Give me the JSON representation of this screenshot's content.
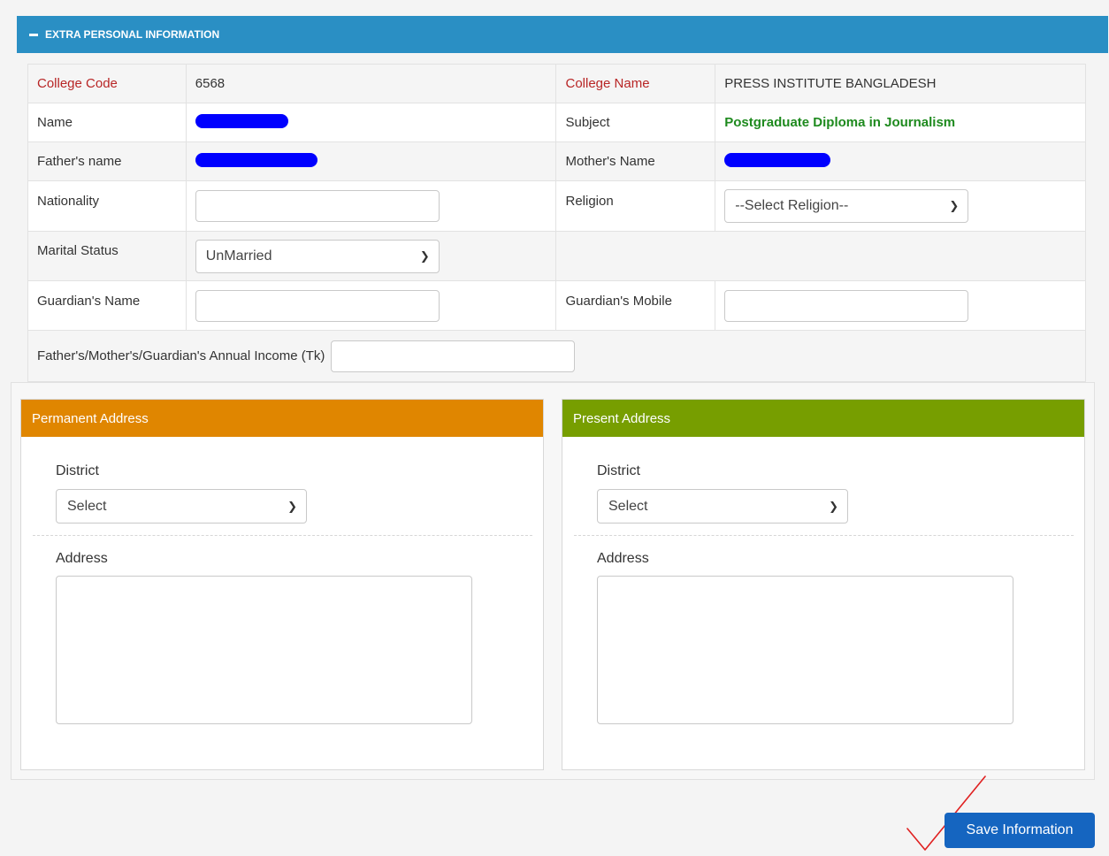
{
  "panel": {
    "title": "EXTRA PERSONAL INFORMATION"
  },
  "rows": {
    "college_code_label": "College Code",
    "college_code_value": "6568",
    "college_name_label": "College Name",
    "college_name_value": "PRESS INSTITUTE BANGLADESH",
    "name_label": "Name",
    "subject_label": "Subject",
    "subject_value": "Postgraduate Diploma in Journalism",
    "father_label": "Father's name",
    "mother_label": "Mother's Name",
    "nationality_label": "Nationality",
    "nationality_value": "",
    "religion_label": "Religion",
    "religion_selected": "--Select Religion--",
    "marital_label": "Marital Status",
    "marital_selected": "UnMarried",
    "guardian_name_label": "Guardian's Name",
    "guardian_name_value": "",
    "guardian_mobile_label": "Guardian's Mobile",
    "guardian_mobile_value": "",
    "income_label": "Father's/Mother's/Guardian's Annual Income (Tk)",
    "income_value": ""
  },
  "permanent": {
    "title": "Permanent Address",
    "district_label": "District",
    "district_selected": "Select",
    "address_label": "Address",
    "address_value": ""
  },
  "present": {
    "title": "Present Address",
    "district_label": "District",
    "district_selected": "Select",
    "address_label": "Address",
    "address_value": ""
  },
  "actions": {
    "save_label": "Save Information"
  },
  "colors": {
    "header_blue": "#2a8fc4",
    "permanent_orange": "#e08600",
    "present_green": "#779e00",
    "button_blue": "#1565c0",
    "redaction_blue": "#0000ff",
    "check_red": "#e02020"
  }
}
